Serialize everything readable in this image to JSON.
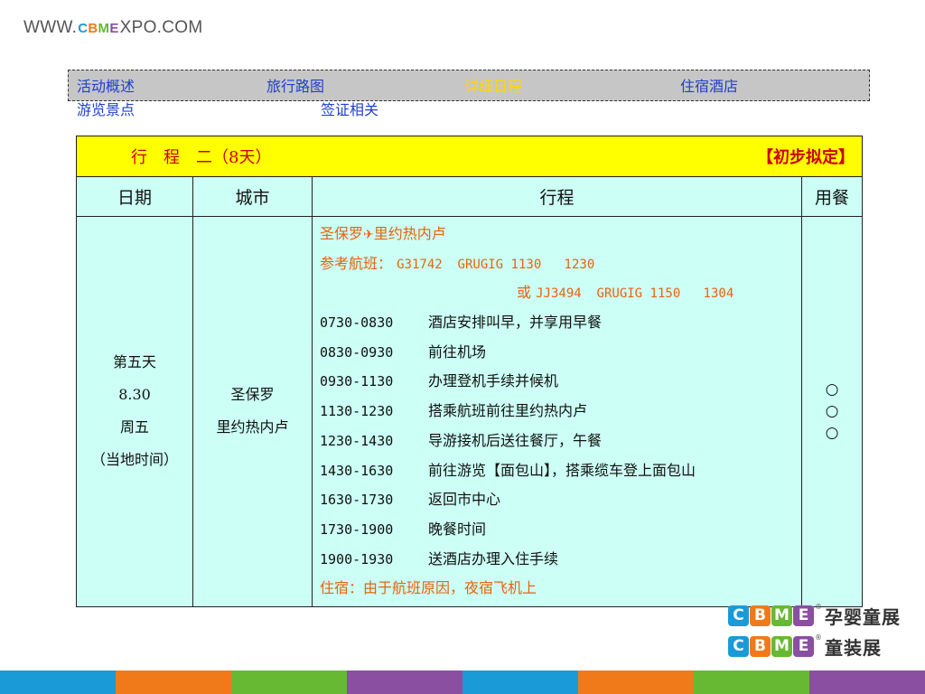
{
  "header": {
    "logo_prefix": "WWW.",
    "logo_brand": "CBME",
    "logo_suffix": "XPO.COM"
  },
  "nav": {
    "items": [
      {
        "label": "活动概述",
        "active": false
      },
      {
        "label": "旅行路图",
        "active": false
      },
      {
        "label": "详细日程",
        "active": true
      },
      {
        "label": "住宿酒店",
        "active": false
      },
      {
        "label": "游览景点",
        "active": false
      },
      {
        "label": "签证相关",
        "active": false
      }
    ]
  },
  "table": {
    "title": "行　程　二（8天）",
    "status": "【初步拟定】",
    "headers": {
      "date": "日期",
      "city": "城市",
      "schedule": "行程",
      "meals": "用餐"
    },
    "day": {
      "day_label": "第五天",
      "date": "8.30",
      "weekday": "周五",
      "time_note": "（当地时间）"
    },
    "city": {
      "line1": "圣保罗",
      "line2": "里约热内卢"
    },
    "route": {
      "from": "圣保罗",
      "plane_icon": "airplane-icon",
      "to": "里约热内卢"
    },
    "flights": {
      "label": "参考航班：",
      "flight1": "G31742  GRUGIG 1130   1230",
      "alt_prefix": "或",
      "flight2": "JJ3494  GRUGIG 1150   1304"
    },
    "schedule": [
      {
        "time": "0730-0830",
        "desc": "酒店安排叫早，并享用早餐"
      },
      {
        "time": "0830-0930",
        "desc": "前往机场"
      },
      {
        "time": "0930-1130",
        "desc": "办理登机手续并候机"
      },
      {
        "time": "1130-1230",
        "desc": "搭乘航班前往里约热内卢"
      },
      {
        "time": "1230-1430",
        "desc": "导游接机后送往餐厅，午餐"
      },
      {
        "time": "1430-1630",
        "desc": "前往游览【面包山】，搭乘缆车登上面包山"
      },
      {
        "time": "1630-1730",
        "desc": "返回市中心"
      },
      {
        "time": "1730-1900",
        "desc": "晚餐时间"
      },
      {
        "time": "1900-1930",
        "desc": "送酒店办理入住手续"
      }
    ],
    "lodging": "住宿：由于航班原因，夜宿飞机上",
    "meals": [
      "○",
      "○",
      "○"
    ]
  },
  "footer_logos": [
    {
      "brand": "CBME",
      "tm": "®",
      "label": "孕婴童展"
    },
    {
      "brand": "CBME",
      "tm": "®",
      "label": "童装展"
    }
  ],
  "colors": {
    "title_bg": "#ffff00",
    "title_text": "#cc0000",
    "cell_bg": "#ccfff5",
    "nav_bg": "#c6c6c6",
    "nav_link": "#1f3fd0",
    "nav_active": "#ffd800",
    "accent_orange": "#e8620f",
    "stripe": [
      "#1a9ad6",
      "#f07a1a",
      "#67b832",
      "#8a4fa0",
      "#1a9ad6",
      "#f07a1a",
      "#67b832",
      "#8a4fa0"
    ]
  }
}
